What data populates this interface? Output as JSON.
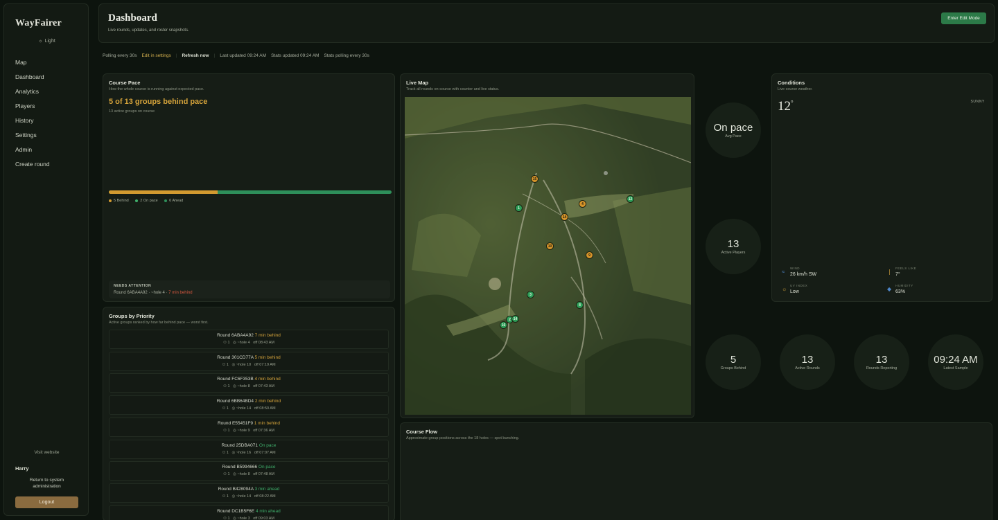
{
  "sidebar": {
    "logo": "WayFairer",
    "theme_toggle": "Light",
    "nav": [
      "Map",
      "Dashboard",
      "Analytics",
      "Players",
      "History",
      "Settings",
      "Admin",
      "Create round"
    ],
    "visit_website": "Visit website",
    "user_name": "Harry",
    "return_admin": "Return to system administration",
    "logout": "Logout"
  },
  "header": {
    "title": "Dashboard",
    "subtitle": "Live rounds, updates, and roster snapshots.",
    "edit_mode_button": "Enter Edit Mode"
  },
  "status_bar": {
    "polling": "Polling every 30s",
    "edit_settings": "Edit in settings",
    "refresh": "Refresh now",
    "last_updated": "Last updated 09:24 AM",
    "stats_updated": "Stats updated 09:24 AM",
    "stats_polling": "Stats polling every 30s"
  },
  "course_pace": {
    "title": "Course Pace",
    "subtitle": "How the whole course is running against expected pace.",
    "headline": "5 of 13 groups behind pace",
    "sub": "13 active groups on course",
    "behind_count": 5,
    "onpace_count": 2,
    "ahead_count": 6,
    "behind_fraction": 0.385,
    "legend": {
      "behind": "5 Behind",
      "onpace": "2 On pace",
      "ahead": "6 Ahead"
    },
    "attention_label": "NEEDS ATTENTION",
    "attention_text": "Round 6ABA4A92 · ~hole 4 · ",
    "attention_delay": "7 min behind"
  },
  "groups": {
    "title": "Groups by Priority",
    "subtitle": "Active groups ranked by how far behind pace — worst first.",
    "rows": [
      {
        "round": "Round 6ABA4A92",
        "status": "7 min behind",
        "kind": "behind",
        "players": "1",
        "hole": "~hole 4",
        "off": "off 08:43 AM"
      },
      {
        "round": "Round 301CD77A",
        "status": "5 min behind",
        "kind": "behind",
        "players": "1",
        "hole": "~hole 10",
        "off": "off 07:19 AM"
      },
      {
        "round": "Round FC6F353B",
        "status": "4 min behind",
        "kind": "behind",
        "players": "1",
        "hole": "~hole 8",
        "off": "off 07:43 AM"
      },
      {
        "round": "Round 6BB64BD4",
        "status": "2 min behind",
        "kind": "behind",
        "players": "1",
        "hole": "~hole 14",
        "off": "off 08:50 AM"
      },
      {
        "round": "Round E55451F9",
        "status": "1 min behind",
        "kind": "behind",
        "players": "1",
        "hole": "~hole 9",
        "off": "off 07:36 AM"
      },
      {
        "round": "Round 25DBA071",
        "status": "On pace",
        "kind": "onpace",
        "players": "1",
        "hole": "~hole 16",
        "off": "off 07:07 AM"
      },
      {
        "round": "Round B5994666",
        "status": "On pace",
        "kind": "onpace",
        "players": "1",
        "hole": "~hole 8",
        "off": "off 07:48 AM"
      },
      {
        "round": "Round B428094A",
        "status": "3 min ahead",
        "kind": "ahead",
        "players": "1",
        "hole": "~hole 14",
        "off": "off 08:22 AM"
      },
      {
        "round": "Round DC1B5F6E",
        "status": "4 min ahead",
        "kind": "ahead",
        "players": "1",
        "hole": "~hole 3",
        "off": "off 09:03 AM"
      }
    ]
  },
  "live_map": {
    "title": "Live Map",
    "subtitle": "Track all rounds on-course with counter and live status."
  },
  "stats": {
    "avg_pace": {
      "value": "On pace",
      "label": "Avg Pace"
    },
    "active_players": {
      "value": "13",
      "label": "Active Players"
    },
    "groups_behind": {
      "value": "5",
      "label": "Groups Behind"
    },
    "active_rounds": {
      "value": "13",
      "label": "Active Rounds"
    },
    "rounds_reporting": {
      "value": "13",
      "label": "Rounds Reporting"
    },
    "latest_sample": {
      "value": "09:24 AM",
      "label": "Latest Sample"
    }
  },
  "conditions": {
    "title": "Conditions",
    "subtitle": "Live course weather.",
    "temp": "12",
    "degree": "°",
    "sky": "SUNNY",
    "wind_label": "WIND",
    "wind_value": "26 km/h SW",
    "feels_label": "FEELS LIKE",
    "feels_value": "7°",
    "uv_label": "UV INDEX",
    "uv_value": "Low",
    "humidity_label": "HUMIDITY",
    "humidity_value": "63%"
  },
  "course_flow": {
    "title": "Course Flow",
    "subtitle": "Approximate group positions across the 18 holes — spot bunching."
  },
  "colors": {
    "accent": "#2c7a48",
    "behind": "#d6a43b",
    "ontrack": "#3fae6b",
    "alert": "#d9583f",
    "logout": "#8a6b3f"
  }
}
